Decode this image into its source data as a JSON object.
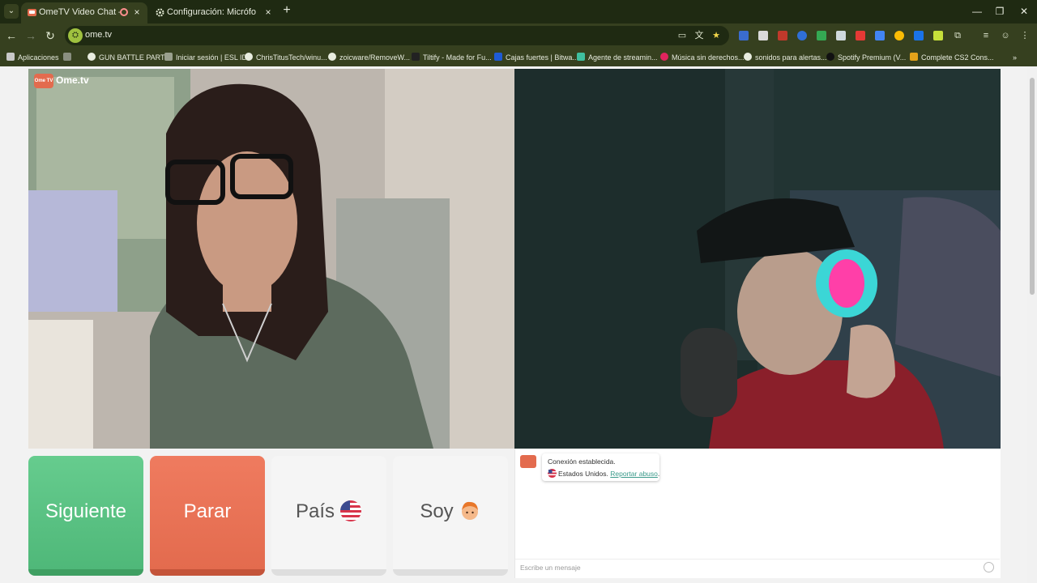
{
  "browser": {
    "tabs": [
      {
        "title": "OmeTV Video Chat — Ome",
        "active": true
      },
      {
        "title": "Configuración: Micrófono",
        "active": false
      }
    ],
    "url": "ome.tv",
    "bookmarks": [
      "Aplicaciones",
      "GUN BATTLE PARTY",
      "Iniciar sesión | ESL ID",
      "ChrisTitusTech/winu...",
      "zoicware/RemoveW...",
      "Tiltify - Made for Fu...",
      "Cajas fuertes | Bitwa...",
      "Agente de streamin...",
      "Música sin derechos...",
      "sonidos para alertas...",
      "Spotify Premium (V...",
      "Complete CS2 Cons..."
    ]
  },
  "site": {
    "logo_text": "Ome.tv",
    "logo_badge": "Ome TV"
  },
  "buttons": {
    "next": "Siguiente",
    "stop": "Parar",
    "country": "País",
    "gender": "Soy"
  },
  "chat": {
    "status": "Conexión establecida.",
    "country": "Estados Unidos.",
    "report_link": "Reportar abuso",
    "report_suffix": ".",
    "input_placeholder": "Escribe un mensaje"
  },
  "colors": {
    "next": "#4fb879",
    "stop": "#e36b4e",
    "browser_frame": "#36401f",
    "link": "#3a9a8a"
  }
}
